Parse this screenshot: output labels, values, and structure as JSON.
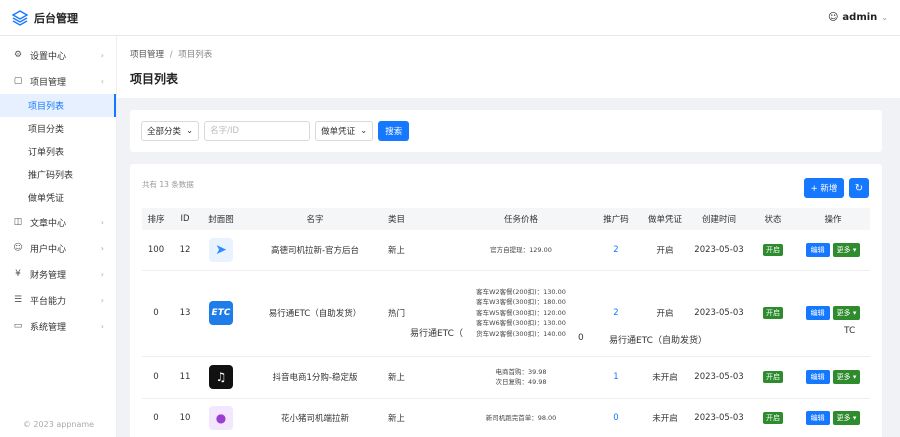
{
  "app": {
    "title": "后台管理",
    "user": "admin"
  },
  "sidebar": {
    "items": [
      {
        "label": "设置中心",
        "icon": "gear-icon"
      },
      {
        "label": "项目管理",
        "icon": "cube-icon"
      },
      {
        "label": "文章中心",
        "icon": "book-icon"
      },
      {
        "label": "用户中心",
        "icon": "user-icon"
      },
      {
        "label": "财务管理",
        "icon": "yen-icon"
      },
      {
        "label": "平台能力",
        "icon": "layers-icon"
      },
      {
        "label": "系统管理",
        "icon": "monitor-icon"
      }
    ],
    "sub_items": [
      "项目列表",
      "项目分类",
      "订单列表",
      "推广码列表",
      "做单凭证"
    ],
    "copyright": "© 2023 appname"
  },
  "breadcrumb": {
    "parent": "项目管理",
    "sep": "/",
    "current": "项目列表"
  },
  "page_title": "项目列表",
  "filter": {
    "category": "全部分类",
    "search_placeholder": "名字/ID",
    "voucher": "做单凭证",
    "search_button": "搜索"
  },
  "toolbar": {
    "total": "共有 13 条数据",
    "add": "+ 新增"
  },
  "table": {
    "headers": [
      "排序",
      "ID",
      "封面图",
      "名字",
      "类目",
      "任务价格",
      "推广码",
      "做单凭证",
      "创建时间",
      "状态",
      "操作"
    ],
    "rows": [
      {
        "sort": "100",
        "id": "12",
        "name": "高德司机拉新-官方后台",
        "category": "新上",
        "price": [
          "官方自提现：129.00"
        ],
        "qr": "2",
        "voucher": "开启",
        "date": "2023-05-03",
        "status": "开启",
        "edit": "编辑",
        "more": "更多",
        "cover_color": "#2f8cff"
      },
      {
        "sort": "0",
        "id": "13",
        "name": "易行通ETC（自助发货）",
        "category": "热门",
        "price": [
          "客车W2客餐(200扣)：130.00",
          "客车W3客餐(300扣)：180.00",
          "客车W5客餐(300扣)：120.00",
          "客车W6客餐(300扣)：130.00",
          "货车W2客餐(300扣)：140.00"
        ],
        "qr": "2",
        "voucher": "开启",
        "date": "2023-05-03",
        "status": "开启",
        "edit": "编辑",
        "more": "更多",
        "cover_color": "#1e7de8",
        "cover_text": "ETC"
      },
      {
        "sort": "0",
        "id": "11",
        "name": "抖音电商1分购-稳定版",
        "category": "新上",
        "price": [
          "电商首购：39.98",
          "次日复购：49.98"
        ],
        "qr": "1",
        "voucher": "未开启",
        "date": "2023-05-03",
        "status": "开启",
        "edit": "编辑",
        "more": "更多",
        "cover_color": "#111111"
      },
      {
        "sort": "0",
        "id": "10",
        "name": "花小猪司机端拉新",
        "category": "新上",
        "price": [
          "新司机跑完首单：98.00"
        ],
        "qr": "0",
        "voucher": "未开启",
        "date": "2023-05-03",
        "status": "开启",
        "edit": "编辑",
        "more": "更多",
        "cover_color": "#9b3fd0"
      }
    ]
  },
  "overlay": {
    "text_a": "易行通ETC（",
    "text_b": "0",
    "text_c": "易行通ETC（自助发货）",
    "text_d": "TC"
  }
}
